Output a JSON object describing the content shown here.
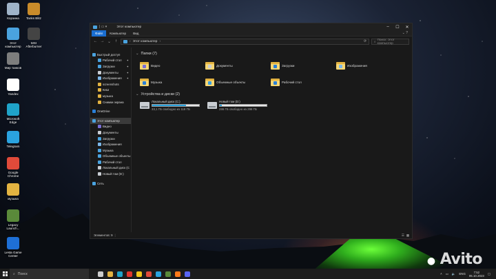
{
  "desktop": {
    "icons": [
      {
        "label": "Корзина",
        "icon": "recycle-bin-icon",
        "color": "#9fb3c8"
      },
      {
        "label": "Tanks Blitz",
        "icon": "tanks-blitz-icon",
        "color": "#c98b2a"
      },
      {
        "label": "Этот компьютер",
        "icon": "this-pc-icon",
        "color": "#4aa3df"
      },
      {
        "label": "MSI Afterburner",
        "icon": "msi-afterburner-icon",
        "color": "#444444"
      },
      {
        "label": "Мир танков",
        "icon": "world-of-tanks-icon",
        "color": "#7d7d7d"
      },
      {
        "label": "Yandex",
        "icon": "yandex-icon",
        "color": "#ffffff"
      },
      {
        "label": "Microsoft Edge",
        "icon": "edge-icon",
        "color": "#1fa3c9"
      },
      {
        "label": "Telegram",
        "icon": "telegram-icon",
        "color": "#2aa3e0"
      },
      {
        "label": "Google Chrome",
        "icon": "chrome-icon",
        "color": "#e04a3a"
      },
      {
        "label": "музыка",
        "icon": "folder-icon",
        "color": "#e3b341"
      },
      {
        "label": "Legacy Launch...",
        "icon": "minecraft-icon",
        "color": "#5a8a3a"
      },
      {
        "label": "Lesta Game Center",
        "icon": "lesta-icon",
        "color": "#1e6fd6"
      }
    ]
  },
  "window": {
    "title": "Этот компьютер",
    "tabs": [
      "Файл",
      "Компьютер",
      "Вид"
    ],
    "address": "Этот компьютер",
    "search_placeholder": "Поиск: Этот компьютер",
    "nav": [
      {
        "label": "Быстрый доступ",
        "sub": false,
        "color": "#4aa3df",
        "pin": false
      },
      {
        "label": "Рабочий стол",
        "sub": true,
        "color": "#4aa3df",
        "pin": true
      },
      {
        "label": "Загрузки",
        "sub": true,
        "color": "#4aa3df",
        "pin": true
      },
      {
        "label": "Документы",
        "sub": true,
        "color": "#c9cdd2",
        "pin": true
      },
      {
        "label": "Изображения",
        "sub": true,
        "color": "#7db7e8",
        "pin": true
      },
      {
        "label": "screenshots",
        "sub": true,
        "color": "#e3b341",
        "pin": false
      },
      {
        "label": "КеШ",
        "sub": true,
        "color": "#e3b341",
        "pin": false
      },
      {
        "label": "музыка",
        "sub": true,
        "color": "#e3b341",
        "pin": false
      },
      {
        "label": "Снимки экрана",
        "sub": true,
        "color": "#e3b341",
        "pin": false
      },
      {
        "label": "",
        "gap": true
      },
      {
        "label": "OneDrive",
        "sub": false,
        "color": "#2a7fd6",
        "pin": false
      },
      {
        "label": "",
        "gap": true
      },
      {
        "label": "Этот компьютер",
        "sub": false,
        "color": "#4aa3df",
        "pin": false,
        "selected": true
      },
      {
        "label": "Видео",
        "sub": true,
        "color": "#7a6fd6",
        "pin": false
      },
      {
        "label": "Документы",
        "sub": true,
        "color": "#c9cdd2",
        "pin": false
      },
      {
        "label": "Загрузки",
        "sub": true,
        "color": "#4aa3df",
        "pin": false
      },
      {
        "label": "Изображения",
        "sub": true,
        "color": "#7db7e8",
        "pin": false
      },
      {
        "label": "Музыка",
        "sub": true,
        "color": "#4aa3df",
        "pin": false
      },
      {
        "label": "Объемные объекты",
        "sub": true,
        "color": "#4aa3df",
        "pin": false
      },
      {
        "label": "Рабочий стол",
        "sub": true,
        "color": "#4aa3df",
        "pin": false
      },
      {
        "label": "Локальный диск (C",
        "sub": true,
        "color": "#c9cdd2",
        "pin": false
      },
      {
        "label": "Новый том (D:)",
        "sub": true,
        "color": "#c9cdd2",
        "pin": false
      },
      {
        "label": "",
        "gap": true
      },
      {
        "label": "Сеть",
        "sub": false,
        "color": "#4aa3df",
        "pin": false
      }
    ],
    "folders_header": "Папки (7)",
    "folders": [
      {
        "label": "Видео",
        "badge": "#7a6fd6"
      },
      {
        "label": "Документы",
        "badge": "#c9cdd2"
      },
      {
        "label": "Загрузки",
        "badge": "#2a7fd6"
      },
      {
        "label": "Изображения",
        "badge": "#7db7e8"
      },
      {
        "label": "Музыка",
        "badge": "#2a7fd6"
      },
      {
        "label": "Объемные объекты",
        "badge": "#3aa0e0"
      },
      {
        "label": "Рабочий стол",
        "badge": "#2a7fd6"
      }
    ],
    "drives_header": "Устройства и диски (2)",
    "drives": [
      {
        "name": "Локальный диск (C:)",
        "free": "33,1 ГБ свободно из 118 ГБ",
        "used_fraction": 0.72
      },
      {
        "name": "Новый том (D:)",
        "free": "286 ГБ свободно из 298 ГБ",
        "used_fraction": 0.04
      }
    ],
    "status": "Элементов: 9"
  },
  "taskbar": {
    "search_placeholder": "Поиск",
    "apps": [
      {
        "icon": "task-view-icon",
        "color": "#cccccc"
      },
      {
        "icon": "file-explorer-icon",
        "color": "#e3b341"
      },
      {
        "icon": "edge-icon",
        "color": "#1fa3c9"
      },
      {
        "icon": "yandex-icon",
        "color": "#e0362c"
      },
      {
        "icon": "yandex-browser-icon",
        "color": "#f5c518"
      },
      {
        "icon": "chrome-icon",
        "color": "#e04a3a"
      },
      {
        "icon": "telegram-icon",
        "color": "#2aa3e0"
      },
      {
        "icon": "minecraft-icon",
        "color": "#5a8a3a"
      },
      {
        "icon": "firefox-icon",
        "color": "#ff7a1a"
      },
      {
        "icon": "discord-icon",
        "color": "#5865f2"
      }
    ],
    "lang": "ENG",
    "time": "7:52",
    "date": "05.10.2023"
  },
  "watermark": "Avito"
}
